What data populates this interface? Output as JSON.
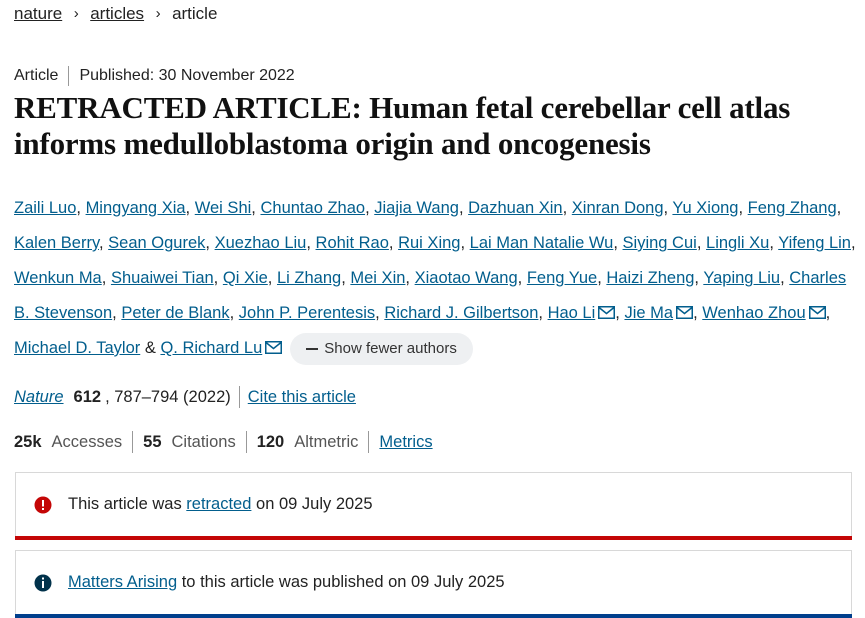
{
  "breadcrumb": {
    "items": [
      "nature",
      "articles"
    ],
    "current": "article"
  },
  "meta": {
    "type": "Article",
    "published": "Published: 30 November 2022"
  },
  "title": "RETRACTED ARTICLE: Human fetal cerebellar cell atlas informs medulloblastoma origin and oncogenesis",
  "authors": [
    "Zaili Luo",
    "Mingyang Xia",
    "Wei Shi",
    "Chuntao Zhao",
    "Jiajia Wang",
    "Dazhuan Xin",
    "Xinran Dong",
    "Yu Xiong",
    "Feng Zhang",
    "Kalen Berry",
    "Sean Ogurek",
    "Xuezhao Liu",
    "Rohit Rao",
    "Rui Xing",
    "Lai Man Natalie Wu",
    "Siying Cui",
    "Lingli Xu",
    "Yifeng Lin",
    "Wenkun Ma",
    "Shuaiwei Tian",
    "Qi Xie",
    "Li Zhang",
    "Mei Xin",
    "Xiaotao Wang",
    "Feng Yue",
    "Haizi Zheng",
    "Yaping Liu",
    "Charles B. Stevenson",
    "Peter de Blank",
    "John P. Perentesis",
    "Richard J. Gilbertson",
    "Hao Li",
    "Jie Ma",
    "Wenhao Zhou",
    "Michael D. Taylor",
    "Q. Richard Lu"
  ],
  "authors_separator": ",",
  "authors_last_joiner": "&",
  "show_fewer_label": "Show fewer authors",
  "citation": {
    "journal": "Nature",
    "volume": "612",
    "pages": ", 787–794 (2022)",
    "cite_link": "Cite this article"
  },
  "metrics": {
    "accesses_value": "25k",
    "accesses_label": "Accesses",
    "citations_value": "55",
    "citations_label": "Citations",
    "altmetric_value": "120",
    "altmetric_label": "Altmetric",
    "metrics_link": "Metrics"
  },
  "notices": {
    "retracted": {
      "pre": "This article was",
      "link": "retracted",
      "post": "on 09 July 2025",
      "icon": "error-icon",
      "color": "#c40606"
    },
    "matters": {
      "pre": "",
      "link": "Matters Arising",
      "post": "to this article was published on 09 July 2025",
      "icon": "info-icon",
      "color": "#01324b"
    }
  },
  "colors": {
    "link": "#025e8d",
    "retracted_bar": "#c40606",
    "matters_bar": "#003f8c"
  }
}
